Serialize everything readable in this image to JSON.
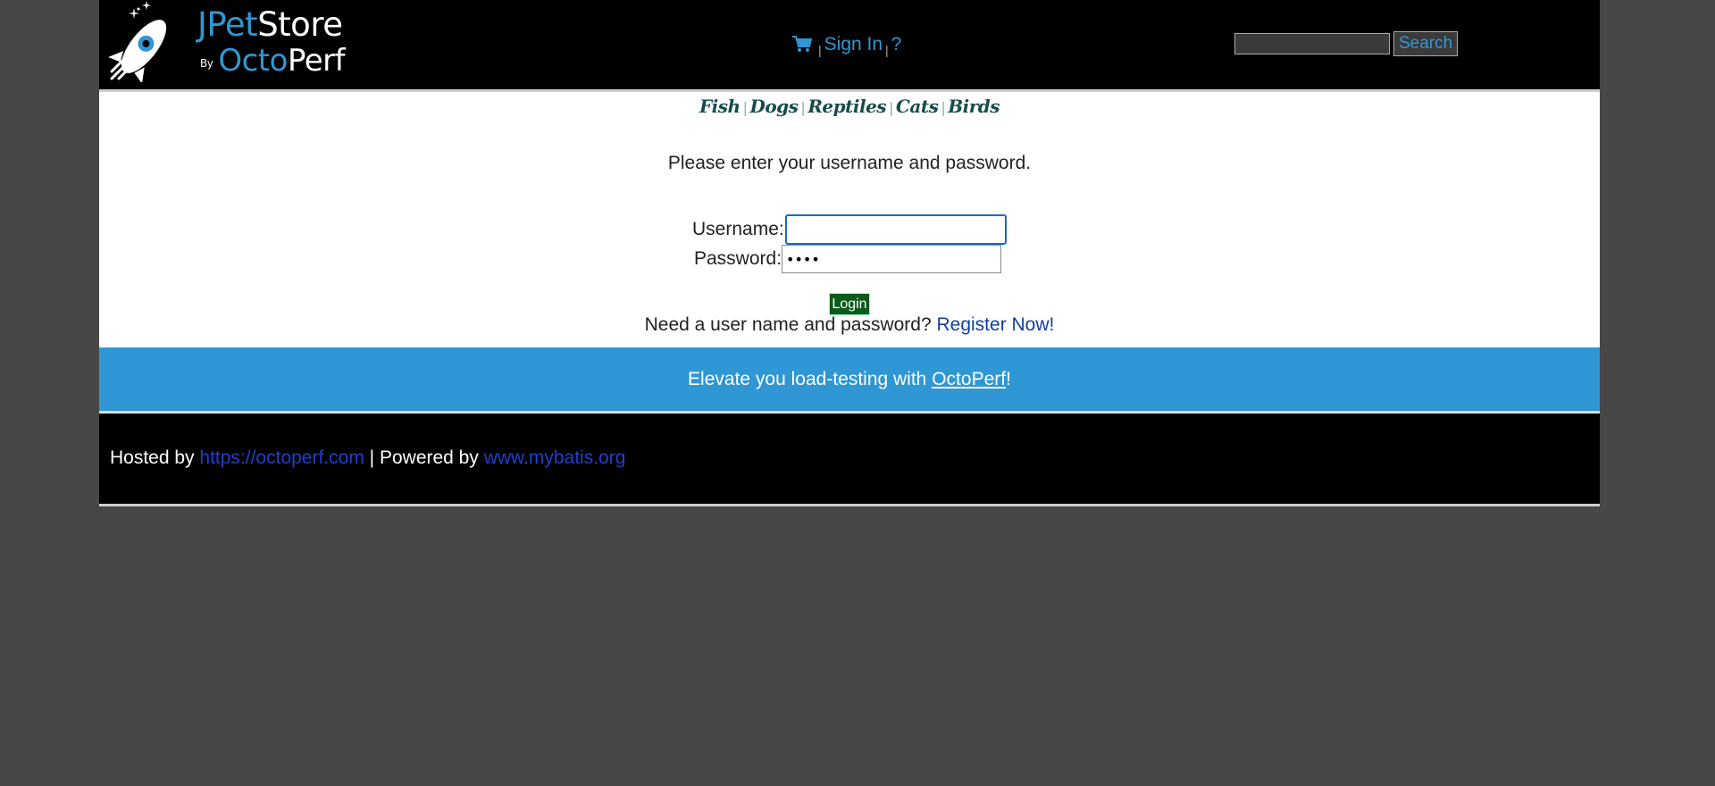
{
  "header": {
    "brand": {
      "line1_part1": "JPet",
      "line1_part2": "Store",
      "by": "By",
      "line2_part1": "Octo",
      "line2_part2": "Perf"
    },
    "menu": {
      "cart_icon": "cart-icon",
      "sign_in": "Sign In",
      "help": "?",
      "separator": "|"
    },
    "search": {
      "query_value": "",
      "button_label": "Search"
    }
  },
  "quicklinks": [
    "Fish",
    "Dogs",
    "Reptiles",
    "Cats",
    "Birds"
  ],
  "quicklinks_separator": "|",
  "login": {
    "prompt": "Please enter your username and password.",
    "username_label": "Username:",
    "username_value": "",
    "password_label": "Password:",
    "password_value": "••••",
    "login_button": "Login",
    "register_prefix": "Need a user name and password?",
    "register_link": "Register Now!"
  },
  "banner": {
    "text_prefix": "Elevate you load-testing with",
    "link": "OctoPerf",
    "text_suffix": "!"
  },
  "footer": {
    "hosted_by": "Hosted by",
    "hosted_link": "https://octoperf.com",
    "powered_by": "| Powered by",
    "powered_link": "www.mybatis.org"
  },
  "colors": {
    "page_bg": "#474747",
    "header_bg": "#000000",
    "accent_blue": "#2f97d4",
    "login_button": "#0b5a1c",
    "link_blue": "#103fa0"
  }
}
